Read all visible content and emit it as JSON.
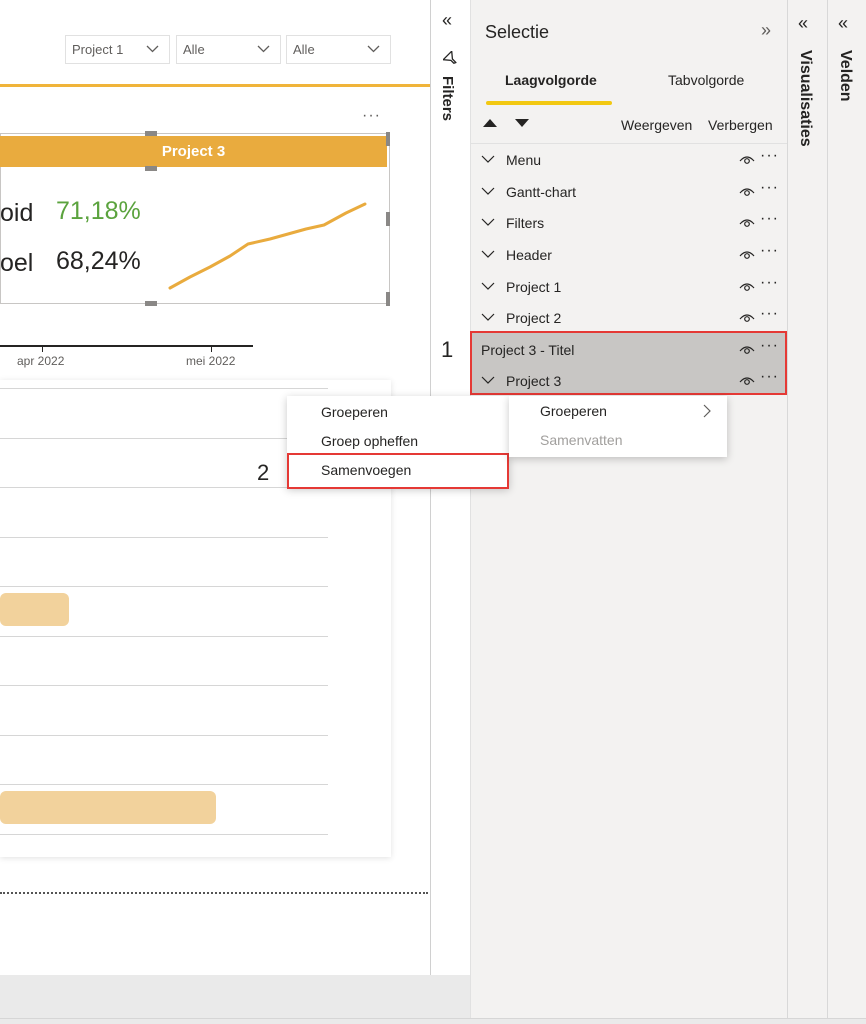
{
  "canvas": {
    "slicers": [
      {
        "value": "Project 1"
      },
      {
        "value": "Alle"
      },
      {
        "value": "Alle"
      }
    ],
    "card": {
      "title": "Project 3",
      "kpis": [
        {
          "label": "oid",
          "value": "71,18%",
          "color": "#5ba33e"
        },
        {
          "label": "oel",
          "value": "68,24%",
          "color": "#252423"
        }
      ],
      "more": "···"
    },
    "axis": {
      "ticks": [
        "apr 2022",
        "mei 2022"
      ]
    }
  },
  "filters_pane": {
    "label": "Filters",
    "collapse": "«"
  },
  "selection": {
    "title": "Selectie",
    "expand": "»",
    "tabs": [
      {
        "label": "Laagvolgorde",
        "active": true
      },
      {
        "label": "Tabvolgorde",
        "active": false
      }
    ],
    "actions": {
      "show": "Weergeven",
      "hide": "Verbergen"
    },
    "layers": [
      {
        "label": "Menu"
      },
      {
        "label": "Gantt-chart"
      },
      {
        "label": "Filters"
      },
      {
        "label": "Header"
      },
      {
        "label": "Project 1"
      },
      {
        "label": "Project 2"
      },
      {
        "label": "Project 3 - Titel"
      },
      {
        "label": "Project 3"
      }
    ]
  },
  "visualisaties_pane": {
    "label": "Visualisaties",
    "collapse": "«"
  },
  "velden_pane": {
    "label": "Velden",
    "collapse": "«"
  },
  "context_menu": {
    "items": [
      "Groeperen",
      "Groep opheffen",
      "Samenvoegen"
    ],
    "submenu": [
      {
        "label": "Groeperen",
        "enabled": true
      },
      {
        "label": "Samenvatten",
        "enabled": false
      }
    ]
  },
  "callouts": [
    "1",
    "2"
  ],
  "colors": {
    "accent": "#f2c811",
    "card_title": "#e9ab3e",
    "highlight_border": "#e53935"
  }
}
